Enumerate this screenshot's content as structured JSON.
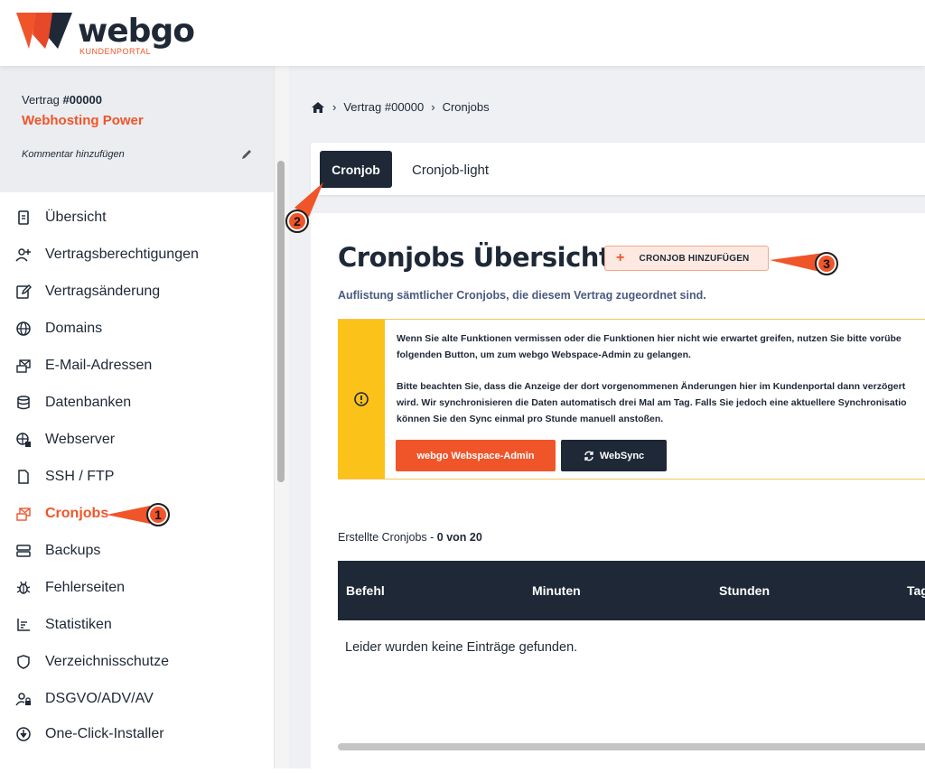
{
  "brand": {
    "name": "webgo",
    "subtitle": "KUNDENPORTAL"
  },
  "contract": {
    "label": "Vertrag",
    "number": "#00000",
    "name": "Webhosting Power",
    "comment": "Kommentar hinzufügen"
  },
  "sidebar": {
    "items": [
      {
        "label": "Übersicht",
        "icon": "document-icon"
      },
      {
        "label": "Vertragsberechtigungen",
        "icon": "user-add-icon"
      },
      {
        "label": "Vertragsänderung",
        "icon": "edit-icon"
      },
      {
        "label": "Domains",
        "icon": "globe-icon"
      },
      {
        "label": "E-Mail-Adressen",
        "icon": "mail-icon"
      },
      {
        "label": "Datenbanken",
        "icon": "database-icon"
      },
      {
        "label": "Webserver",
        "icon": "webserver-icon"
      },
      {
        "label": "SSH / FTP",
        "icon": "file-icon"
      },
      {
        "label": "Cronjobs",
        "icon": "cronjob-icon",
        "active": true
      },
      {
        "label": "Backups",
        "icon": "backup-icon"
      },
      {
        "label": "Fehlerseiten",
        "icon": "bug-icon"
      },
      {
        "label": "Statistiken",
        "icon": "chart-icon"
      },
      {
        "label": "Verzeichnisschutze",
        "icon": "shield-icon"
      },
      {
        "label": "DSGVO/ADV/AV",
        "icon": "user-lock-icon"
      },
      {
        "label": "One-Click-Installer",
        "icon": "download-icon"
      }
    ]
  },
  "breadcrumb": {
    "items": [
      "Vertrag #00000",
      "Cronjobs"
    ]
  },
  "tabs": [
    {
      "label": "Cronjob",
      "active": true
    },
    {
      "label": "Cronjob-light"
    }
  ],
  "main": {
    "title": "Cronjobs Übersicht",
    "add_button": "CRONJOB HINZUFÜGEN",
    "subtitle": "Auflistung sämtlicher Cronjobs, die diesem Vertrag zugeordnet sind."
  },
  "notice": {
    "line1": "Wenn Sie alte Funktionen vermissen oder die Funktionen hier nicht wie erwartet greifen, nutzen Sie bitte vorübe",
    "line2": "folgenden Button, um zum webgo Webspace-Admin zu gelangen.",
    "line3": "Bitte beachten Sie, dass die Anzeige der dort vorgenommenen Änderungen hier im Kundenportal dann verzögert",
    "line4": "wird. Wir synchronisieren die Daten automatisch drei Mal am Tag. Falls Sie jedoch eine aktuellere Synchronisatio",
    "line5": "können Sie den Sync einmal pro Stunde manuell anstoßen.",
    "button_admin": "webgo Webspace-Admin",
    "button_sync": "WebSync"
  },
  "table": {
    "count_label": "Erstellte Cronjobs -",
    "count_value": "0 von 20",
    "headers": [
      "Befehl",
      "Minuten",
      "Stunden",
      "Tag"
    ],
    "empty": "Leider wurden keine Einträge gefunden."
  },
  "callouts": [
    "1",
    "2",
    "3"
  ],
  "colors": {
    "accent": "#f0552a",
    "dark": "#1e2836",
    "warning": "#fbc21a"
  }
}
